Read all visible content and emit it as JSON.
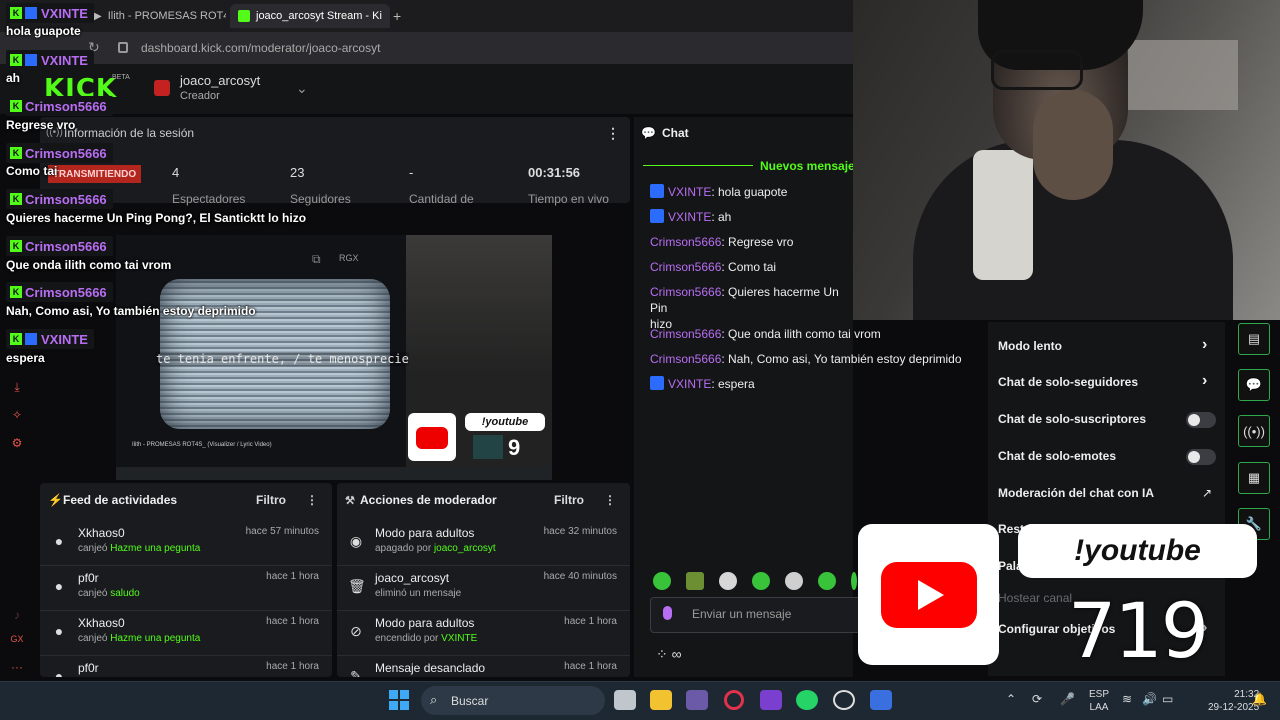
{
  "browser": {
    "tabs": [
      {
        "label": "Ilith - PROMESAS ROT4"
      },
      {
        "label": "joaco_arcosyt Stream - Ki"
      }
    ],
    "new_tab": "+",
    "url": "dashboard.kick.com/moderator/joaco-arcosyt"
  },
  "header": {
    "logo": "KICK",
    "beta": "BETA",
    "username": "joaco_arcosyt",
    "role": "Creador"
  },
  "session": {
    "title": "Información de la sesión",
    "live": "TRANSMITIENDO",
    "stats": [
      {
        "value": "4",
        "label": "Espectadores"
      },
      {
        "value": "23",
        "label": "Seguidores"
      },
      {
        "value": "-",
        "label": "Cantidad de"
      },
      {
        "value": "00:31:56",
        "label": "Tiempo en vivo"
      }
    ]
  },
  "preview": {
    "lyric": "te tenia enfrente, / te menosprecie",
    "rgx": "RGX",
    "video_title": "Ilith - PROMESAS ROT4S_ (Visualizer / Lyric Video)",
    "yt_label": "!youtube",
    "counter": "9"
  },
  "feed": {
    "title": "Feed de actividades",
    "filter": "Filtro",
    "items": [
      {
        "name": "Xkhaos0",
        "action": "canjeó",
        "highlight": "Hazme una pegunta",
        "time": "hace 57 minutos"
      },
      {
        "name": "pf0r",
        "action": "canjeó",
        "highlight": "saludo",
        "time": "hace 1 hora"
      },
      {
        "name": "Xkhaos0",
        "action": "canjeó",
        "highlight": "Hazme una pegunta",
        "time": "hace 1 hora"
      },
      {
        "name": "pf0r",
        "action": "",
        "highlight": "",
        "time": "hace 1 hora"
      }
    ]
  },
  "modactions": {
    "title": "Acciones de moderador",
    "filter": "Filtro",
    "items": [
      {
        "name": "Modo para adultos",
        "action": "apagado por",
        "highlight": "joaco_arcosyt",
        "time": "hace 32 minutos"
      },
      {
        "name": "joaco_arcosyt",
        "action": "eliminó un mensaje",
        "highlight": "",
        "time": "hace 40 minutos"
      },
      {
        "name": "Modo para adultos",
        "action": "encendido por",
        "highlight": "VXINTE",
        "time": "hace 1 hora"
      },
      {
        "name": "Mensaje desanclado",
        "action": "",
        "highlight": "",
        "time": "hace 1 hora"
      }
    ]
  },
  "chat": {
    "title": "Chat",
    "new_messages": "Nuevos mensaje",
    "messages": [
      {
        "user": "VXINTE",
        "text": ": hola guapote",
        "color": "#b86ef2",
        "badge": true
      },
      {
        "user": "VXINTE",
        "text": ": ah",
        "color": "#b86ef2",
        "badge": true
      },
      {
        "user": "Crimson5666",
        "text": ": Regrese vro",
        "color": "#b86ef2",
        "badge": false
      },
      {
        "user": "Crimson5666",
        "text": ": Como tai",
        "color": "#b86ef2",
        "badge": false
      },
      {
        "user": "Crimson5666",
        "text": ": Quieres hacerme Un Pin",
        "text2": "hizo",
        "color": "#b86ef2",
        "badge": false
      },
      {
        "user": "Crimson5666",
        "text": ": Que onda ilith como tai vrom",
        "color": "#b86ef2",
        "badge": false
      },
      {
        "user": "Crimson5666",
        "text": ": Nah, Como asi, Yo también estoy deprimido",
        "color": "#b86ef2",
        "badge": false
      },
      {
        "user": "VXINTE",
        "text": ": espera",
        "color": "#b86ef2",
        "badge": true
      }
    ],
    "placeholder": "Enviar un mensaje"
  },
  "overlay_chat": [
    {
      "user": "VXINTE",
      "msg": "hola guapote"
    },
    {
      "user": "VXINTE",
      "msg": "ah"
    },
    {
      "user": "Crimson5666",
      "msg": "Regrese vro"
    },
    {
      "user": "Crimson5666",
      "msg": "Como tai"
    },
    {
      "user": "Crimson5666",
      "msg": "Quieres hacerme Un Ping Pong?, El Santicktt lo hizo"
    },
    {
      "user": "Crimson5666",
      "msg": "Que onda ilith como tai vrom"
    },
    {
      "user": "Crimson5666",
      "msg": "Nah, Como asi, Yo también estoy deprimido"
    },
    {
      "user": "VXINTE",
      "msg": "espera"
    }
  ],
  "settings": {
    "items": [
      {
        "label": "Modo lento",
        "control": "chevron"
      },
      {
        "label": "Chat de solo-seguidores",
        "control": "chevron"
      },
      {
        "label": "Chat de solo-suscriptores",
        "control": "toggle"
      },
      {
        "label": "Chat de solo-emotes",
        "control": "toggle"
      },
      {
        "label": "Moderación del chat con IA",
        "control": "external"
      },
      {
        "label": "Restricción de cha",
        "control": "chevron"
      },
      {
        "label": "Pala",
        "control": "none"
      },
      {
        "label": "Hostear canal",
        "control": "none"
      },
      {
        "label": "Configurar objetivos",
        "control": "chevron"
      }
    ]
  },
  "youtube_overlay": {
    "label": "!youtube",
    "count": "719"
  },
  "taskbar": {
    "search": "Buscar",
    "lang1": "ESP",
    "lang2": "LAA",
    "time": "21:32",
    "date": "29-12-2025"
  },
  "colors": {
    "kick_green": "#53fc18",
    "username_purple": "#b86ef2",
    "live_red": "#b3261e",
    "overlay_badge_text": "#b86ef2"
  }
}
